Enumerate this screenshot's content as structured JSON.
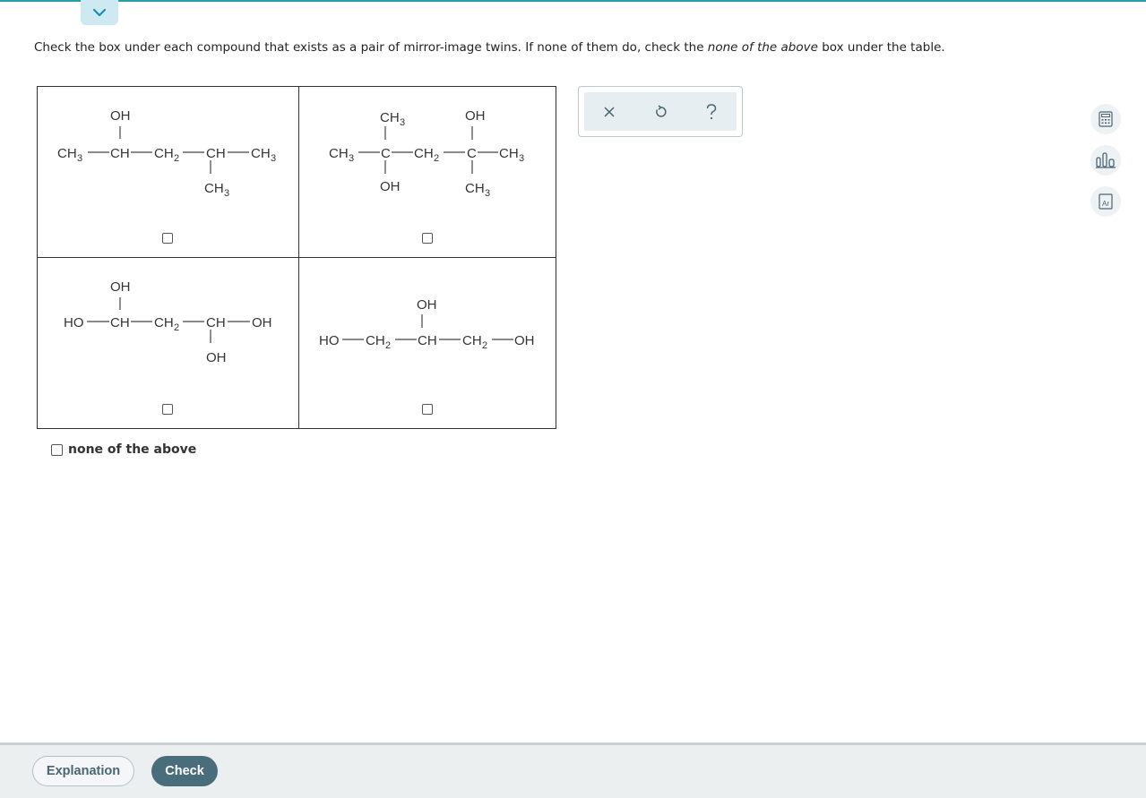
{
  "prompt": {
    "before": "Check the box under each compound that exists as a pair of mirror-image twins. If none of them do, check the ",
    "emphasis": "none of the above",
    "after": " box under the table."
  },
  "compounds": {
    "c1": {
      "top": "OH",
      "a": "CH",
      "a_sub": "3",
      "b": "CH",
      "c": "CH",
      "c_sub": "2",
      "d": "CH",
      "e": "CH",
      "e_sub": "3",
      "bottom": "CH",
      "bottom_sub": "3"
    },
    "c2": {
      "top1": "CH",
      "top1_sub": "3",
      "top2": "OH",
      "a": "CH",
      "a_sub": "3",
      "b": "C",
      "c": "CH",
      "c_sub": "2",
      "d": "C",
      "e": "CH",
      "e_sub": "3",
      "bottom1": "OH",
      "bottom2": "CH",
      "bottom2_sub": "3"
    },
    "c3": {
      "top": "OH",
      "a": "HO",
      "b": "CH",
      "c": "CH",
      "c_sub": "2",
      "d": "CH",
      "e": "OH",
      "bottom": "OH"
    },
    "c4": {
      "top": "OH",
      "a": "HO",
      "b": "CH",
      "b_sub": "2",
      "c": "CH",
      "d": "CH",
      "d_sub": "2",
      "e": "OH"
    }
  },
  "none_of_above": "none of the above",
  "toolbox": {
    "clear_icon": "close-icon",
    "undo_icon": "undo-icon",
    "help_icon": "help-icon"
  },
  "side_tools": [
    "calculator-icon",
    "bar-chart-icon",
    "periodic-table-icon"
  ],
  "periodic_label": "Ar",
  "footer": {
    "explanation": "Explanation",
    "check": "Check"
  },
  "colors": {
    "accent": "#2a9ea8",
    "check_button": "#4a6d7c"
  }
}
